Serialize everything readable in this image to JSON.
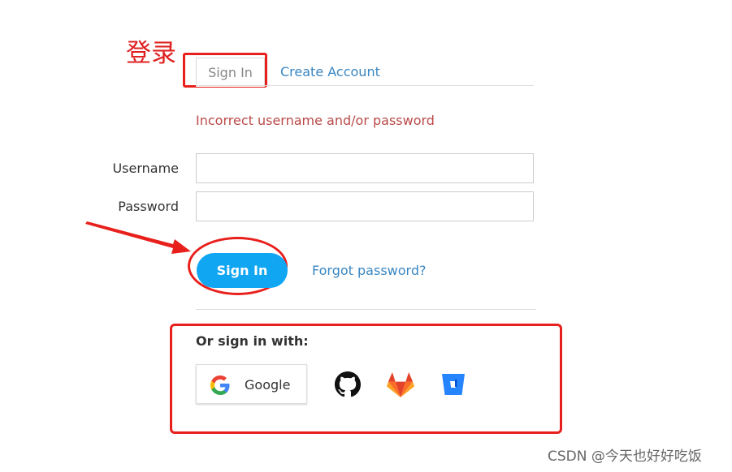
{
  "annotation": {
    "title": "登录"
  },
  "tabs": {
    "signin": "Sign In",
    "create": "Create Account"
  },
  "error_message": "Incorrect username and/or password",
  "form": {
    "username_label": "Username",
    "password_label": "Password",
    "username_value": "",
    "password_value": ""
  },
  "signin_button": "Sign In",
  "forgot_link": "Forgot password?",
  "social": {
    "heading": "Or sign in with:",
    "google_label": "Google",
    "icons": [
      "google-icon",
      "github-icon",
      "gitlab-icon",
      "bitbucket-icon"
    ]
  },
  "watermark": "CSDN @今天也好好吃饭",
  "colors": {
    "accent": "#10a6f2",
    "link": "#3a87c2",
    "error": "#b94a48",
    "annotation": "#e8201c"
  }
}
